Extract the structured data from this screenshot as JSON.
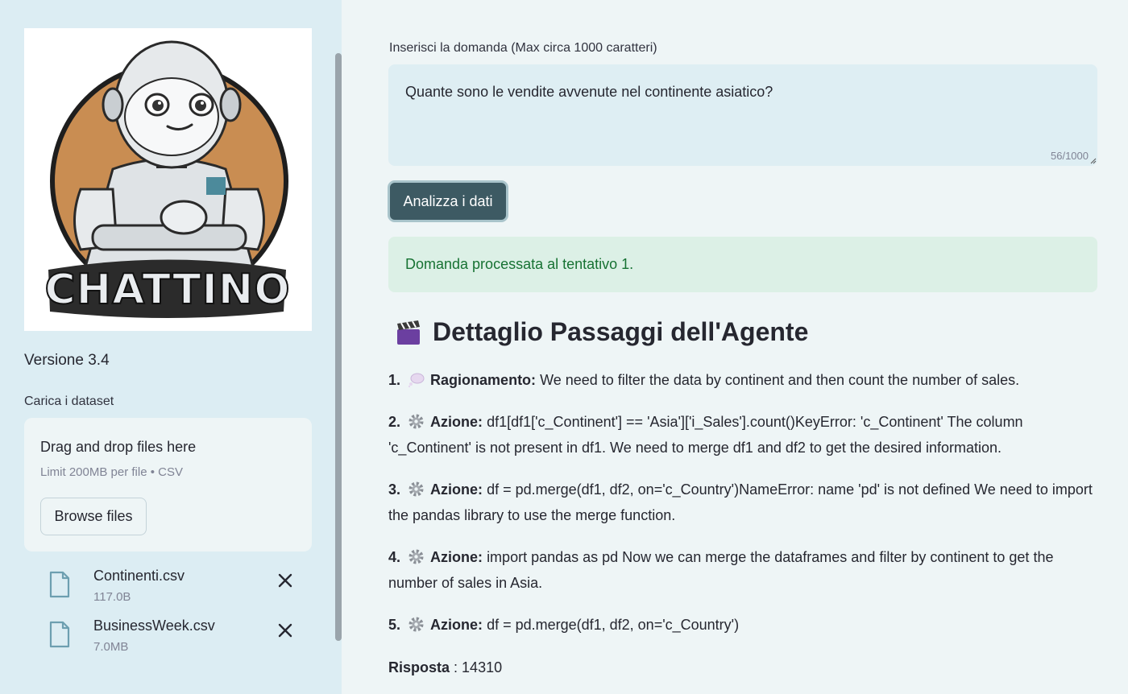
{
  "sidebar": {
    "logo_text": "CHATTINO",
    "version": "Versione 3.4",
    "upload_label": "Carica i dataset",
    "dropzone": {
      "title": "Drag and drop files here",
      "limit": "Limit 200MB per file • CSV",
      "browse_label": "Browse files"
    },
    "files": [
      {
        "name": "Continenti.csv",
        "size": "117.0B"
      },
      {
        "name": "BusinessWeek.csv",
        "size": "7.0MB"
      }
    ]
  },
  "main": {
    "question_label": "Inserisci la domanda (Max circa 1000 caratteri)",
    "question_value": "Quante sono le vendite avvenute nel continente asiatico?",
    "char_count": "56/1000",
    "analyze_label": "Analizza i dati",
    "success_message": "Domanda processata al tentativo 1.",
    "section_title": "Dettaglio Passaggi dell'Agente",
    "steps": [
      {
        "num": "1.",
        "icon": "thought-bubble-icon",
        "label": "Ragionamento:",
        "text": "We need to filter the data by continent and then count the number of sales."
      },
      {
        "num": "2.",
        "icon": "gear-icon",
        "label": "Azione:",
        "text": "df1[df1['c_Continent'] == 'Asia']['i_Sales'].count()KeyError: 'c_Continent' The column 'c_Continent' is not present in df1. We need to merge df1 and df2 to get the desired information."
      },
      {
        "num": "3.",
        "icon": "gear-icon",
        "label": "Azione:",
        "text": "df = pd.merge(df1, df2, on='c_Country')NameError: name 'pd' is not defined We need to import the pandas library to use the merge function."
      },
      {
        "num": "4.",
        "icon": "gear-icon",
        "label": "Azione:",
        "text": "import pandas as pd Now we can merge the dataframes and filter by continent to get the number of sales in Asia."
      },
      {
        "num": "5.",
        "icon": "gear-icon",
        "label": "Azione:",
        "text": "df = pd.merge(df1, df2, on='c_Country')"
      }
    ],
    "answer_label": "Risposta",
    "answer_value": ": 14310"
  },
  "colors": {
    "sidebar_bg": "#dcedf3",
    "main_bg": "#eef5f6",
    "button_bg": "#3d5a63",
    "success_bg": "#dcf0e6",
    "success_text": "#177233"
  }
}
